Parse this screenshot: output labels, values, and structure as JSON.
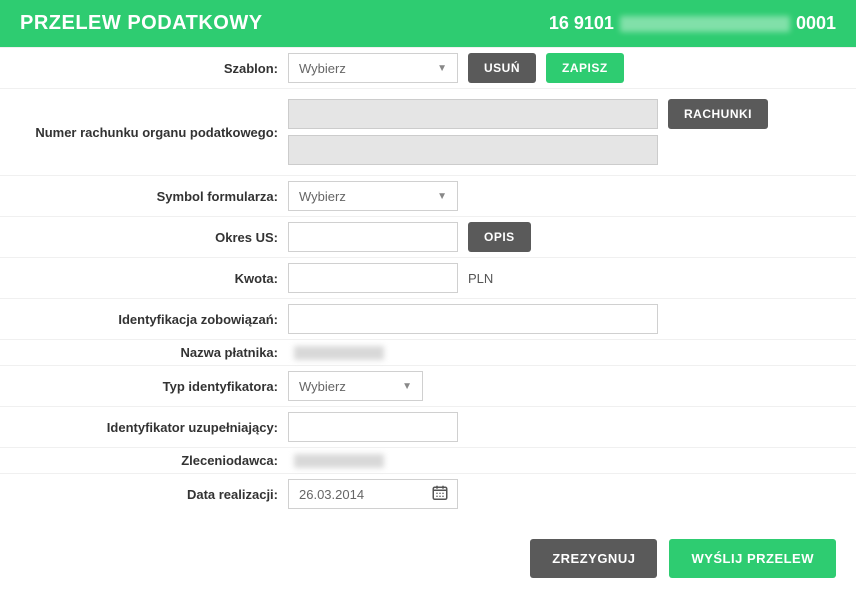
{
  "header": {
    "title": "PRZELEW PODATKOWY",
    "account_prefix": "16 9101",
    "account_suffix": "0001"
  },
  "labels": {
    "szablon": "Szablon:",
    "numer_rachunku": "Numer rachunku organu podatkowego:",
    "symbol_formularza": "Symbol formularza:",
    "okres_us": "Okres US:",
    "kwota": "Kwota:",
    "identyfikacja": "Identyfikacja zobowiązań:",
    "nazwa_platnika": "Nazwa płatnika:",
    "typ_identyfikatora": "Typ identyfikatora:",
    "identyfikator_uzup": "Identyfikator uzupełniający:",
    "zleceniodawca": "Zleceniodawca:",
    "data_realizacji": "Data realizacji:"
  },
  "buttons": {
    "usun": "USUŃ",
    "zapisz": "ZAPISZ",
    "rachunki": "RACHUNKI",
    "opis": "OPIS",
    "zrezygnuj": "ZREZYGNUJ",
    "wyslij": "WYŚLIJ PRZELEW"
  },
  "fields": {
    "szablon_placeholder": "Wybierz",
    "symbol_placeholder": "Wybierz",
    "typ_placeholder": "Wybierz",
    "currency": "PLN",
    "data_realizacji": "26.03.2014"
  }
}
